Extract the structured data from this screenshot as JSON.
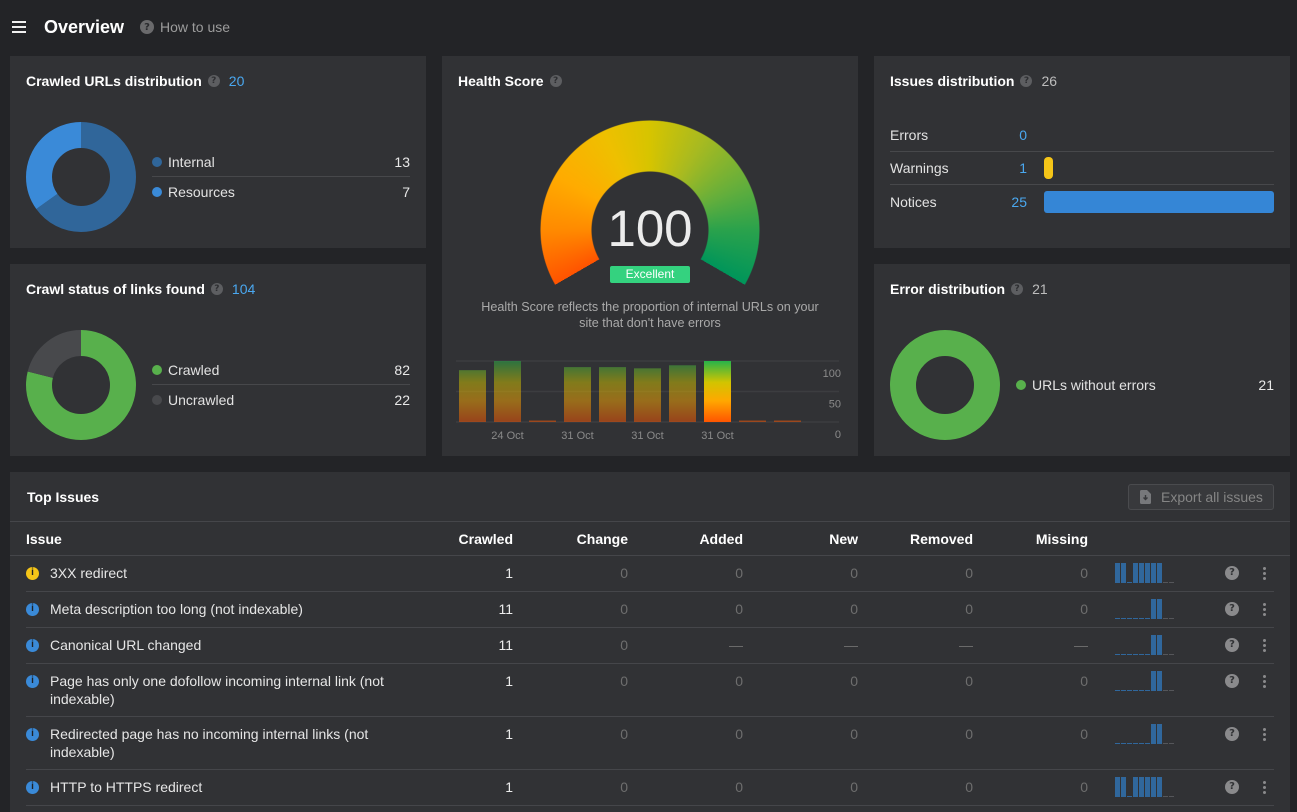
{
  "header": {
    "title": "Overview",
    "help_label": "How to use"
  },
  "panels": {
    "crawled_urls": {
      "title": "Crawled URLs distribution",
      "total": "20"
    },
    "crawl_status": {
      "title": "Crawl status of links found",
      "total": "104"
    },
    "health_score": {
      "title": "Health Score",
      "score": "100",
      "rating": "Excellent",
      "description": [
        "Health Score reflects the proportion of internal URLs on your",
        "site that don't have errors"
      ]
    },
    "issues_distribution": {
      "title": "Issues distribution",
      "total": "26"
    },
    "error_distribution": {
      "title": "Error distribution",
      "total": "21"
    }
  },
  "chart_data": [
    {
      "type": "pie",
      "style": "donut",
      "title": "Crawled URLs distribution",
      "categories": [
        "Internal",
        "Resources"
      ],
      "values": [
        13,
        7
      ],
      "colors": [
        "#30669a",
        "#3a8ad8"
      ],
      "legend": "right"
    },
    {
      "type": "pie",
      "style": "donut",
      "title": "Crawl status of links found",
      "categories": [
        "Crawled",
        "Uncrawled"
      ],
      "values": [
        82,
        22
      ],
      "colors": [
        "#58b04c",
        "#48494c"
      ],
      "legend": "right"
    },
    {
      "type": "bar",
      "title": "Health Score",
      "categories": [
        "",
        "24 Oct",
        "",
        "31 Oct",
        "",
        "31 Oct",
        "",
        "31 Oct",
        "",
        ""
      ],
      "values": [
        85,
        100,
        0,
        90,
        90,
        88,
        93,
        100,
        0,
        0
      ],
      "highlight_index": 7,
      "ylim": [
        0,
        100
      ],
      "yticks": [
        0,
        50,
        100
      ],
      "grid": true,
      "xlabel": "",
      "ylabel": ""
    },
    {
      "type": "bar",
      "orientation": "horizontal",
      "title": "Issues distribution",
      "categories": [
        "Errors",
        "Warnings",
        "Notices"
      ],
      "values": [
        0,
        1,
        25
      ],
      "colors": [
        null,
        "#f5c518",
        "#3586d6"
      ]
    },
    {
      "type": "pie",
      "style": "donut",
      "title": "Error distribution",
      "categories": [
        "URLs without errors"
      ],
      "values": [
        21
      ],
      "colors": [
        "#58b04c"
      ],
      "legend": "right"
    }
  ],
  "top_issues": {
    "title": "Top Issues",
    "export_label": "Export all issues",
    "columns": [
      "Issue",
      "Crawled",
      "Change",
      "Added",
      "New",
      "Removed",
      "Missing"
    ],
    "severity_colors": {
      "warning": "#f5c518",
      "notice": "#3a8ad8"
    },
    "rows": [
      {
        "severity": "warning",
        "issue": "3XX redirect",
        "crawled": "1",
        "change": "0",
        "added": "0",
        "new": "0",
        "removed": "0",
        "missing": "0",
        "trend": [
          1,
          1,
          0,
          1,
          1,
          1,
          1,
          1,
          null,
          null
        ]
      },
      {
        "severity": "notice",
        "issue": "Meta description too long (not indexable)",
        "crawled": "11",
        "change": "0",
        "added": "0",
        "new": "0",
        "removed": "0",
        "missing": "0",
        "trend": [
          0,
          0,
          0,
          0,
          0,
          0,
          1,
          1,
          null,
          null
        ]
      },
      {
        "severity": "notice",
        "issue": "Canonical URL changed",
        "crawled": "11",
        "change": "0",
        "added": "—",
        "new": "—",
        "removed": "—",
        "missing": "—",
        "trend": [
          0,
          0,
          0,
          0,
          0,
          0,
          1,
          1,
          null,
          null
        ]
      },
      {
        "severity": "notice",
        "issue": "Page has only one dofollow incoming internal link (not indexable)",
        "crawled": "1",
        "change": "0",
        "added": "0",
        "new": "0",
        "removed": "0",
        "missing": "0",
        "trend": [
          0,
          0,
          0,
          0,
          0,
          0,
          1,
          1,
          null,
          null
        ]
      },
      {
        "severity": "notice",
        "issue": "Redirected page has no incoming internal links (not indexable)",
        "crawled": "1",
        "change": "0",
        "added": "0",
        "new": "0",
        "removed": "0",
        "missing": "0",
        "trend": [
          0,
          0,
          0,
          0,
          0,
          0,
          1,
          1,
          null,
          null
        ]
      },
      {
        "severity": "notice",
        "issue": "HTTP to HTTPS redirect",
        "crawled": "1",
        "change": "0",
        "added": "0",
        "new": "0",
        "removed": "0",
        "missing": "0",
        "trend": [
          1,
          1,
          0,
          1,
          1,
          1,
          1,
          1,
          null,
          null
        ]
      }
    ]
  }
}
